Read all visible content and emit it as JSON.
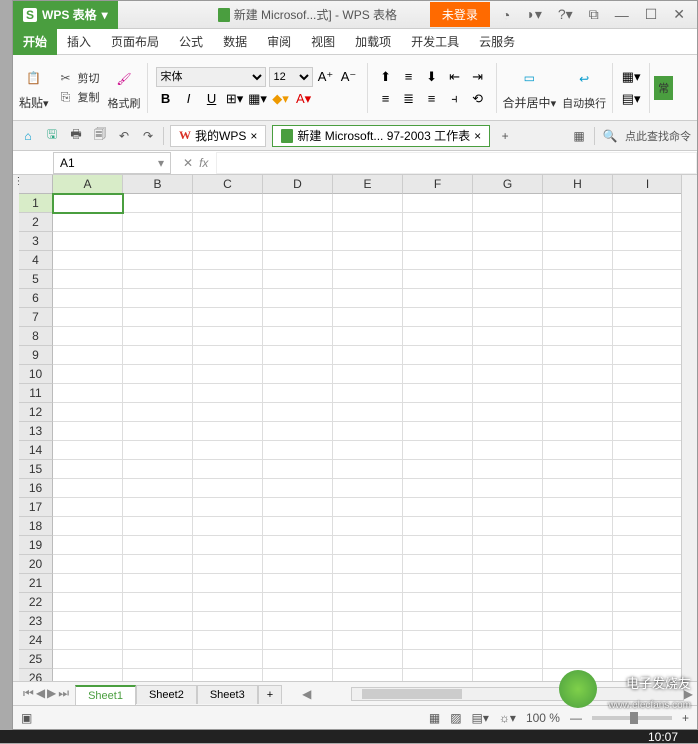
{
  "titlebar": {
    "app_name": "WPS 表格",
    "doc_title": "新建 Microsof...式] - WPS 表格",
    "login_label": "未登录"
  },
  "menu": {
    "items": [
      "开始",
      "插入",
      "页面布局",
      "公式",
      "数据",
      "审阅",
      "视图",
      "加载项",
      "开发工具",
      "云服务"
    ],
    "active_index": 0
  },
  "ribbon": {
    "paste_label": "粘贴",
    "cut_label": "剪切",
    "copy_label": "复制",
    "format_painter_label": "格式刷",
    "font_name": "宋体",
    "font_size": "12",
    "merge_label": "合并居中",
    "wrap_label": "自动换行",
    "more_label": "常"
  },
  "qat": {
    "mywps_label": "我的WPS",
    "doc_tab_label": "新建 Microsoft... 97-2003 工作表",
    "search_label": "点此查找命令"
  },
  "formula": {
    "cell_ref": "A1",
    "fx_label": "fx"
  },
  "grid": {
    "columns": [
      "A",
      "B",
      "C",
      "D",
      "E",
      "F",
      "G",
      "H",
      "I"
    ],
    "rows": 27,
    "selected": "A1",
    "search_strip": "搜"
  },
  "sheets": {
    "tabs": [
      "Sheet1",
      "Sheet2",
      "Sheet3"
    ],
    "active_index": 0,
    "add_label": "+"
  },
  "status": {
    "zoom": "100 %"
  },
  "watermark": {
    "brand": "电子发烧友",
    "url": "www.elecfans.com"
  },
  "taskbar": {
    "time": "10:07"
  }
}
